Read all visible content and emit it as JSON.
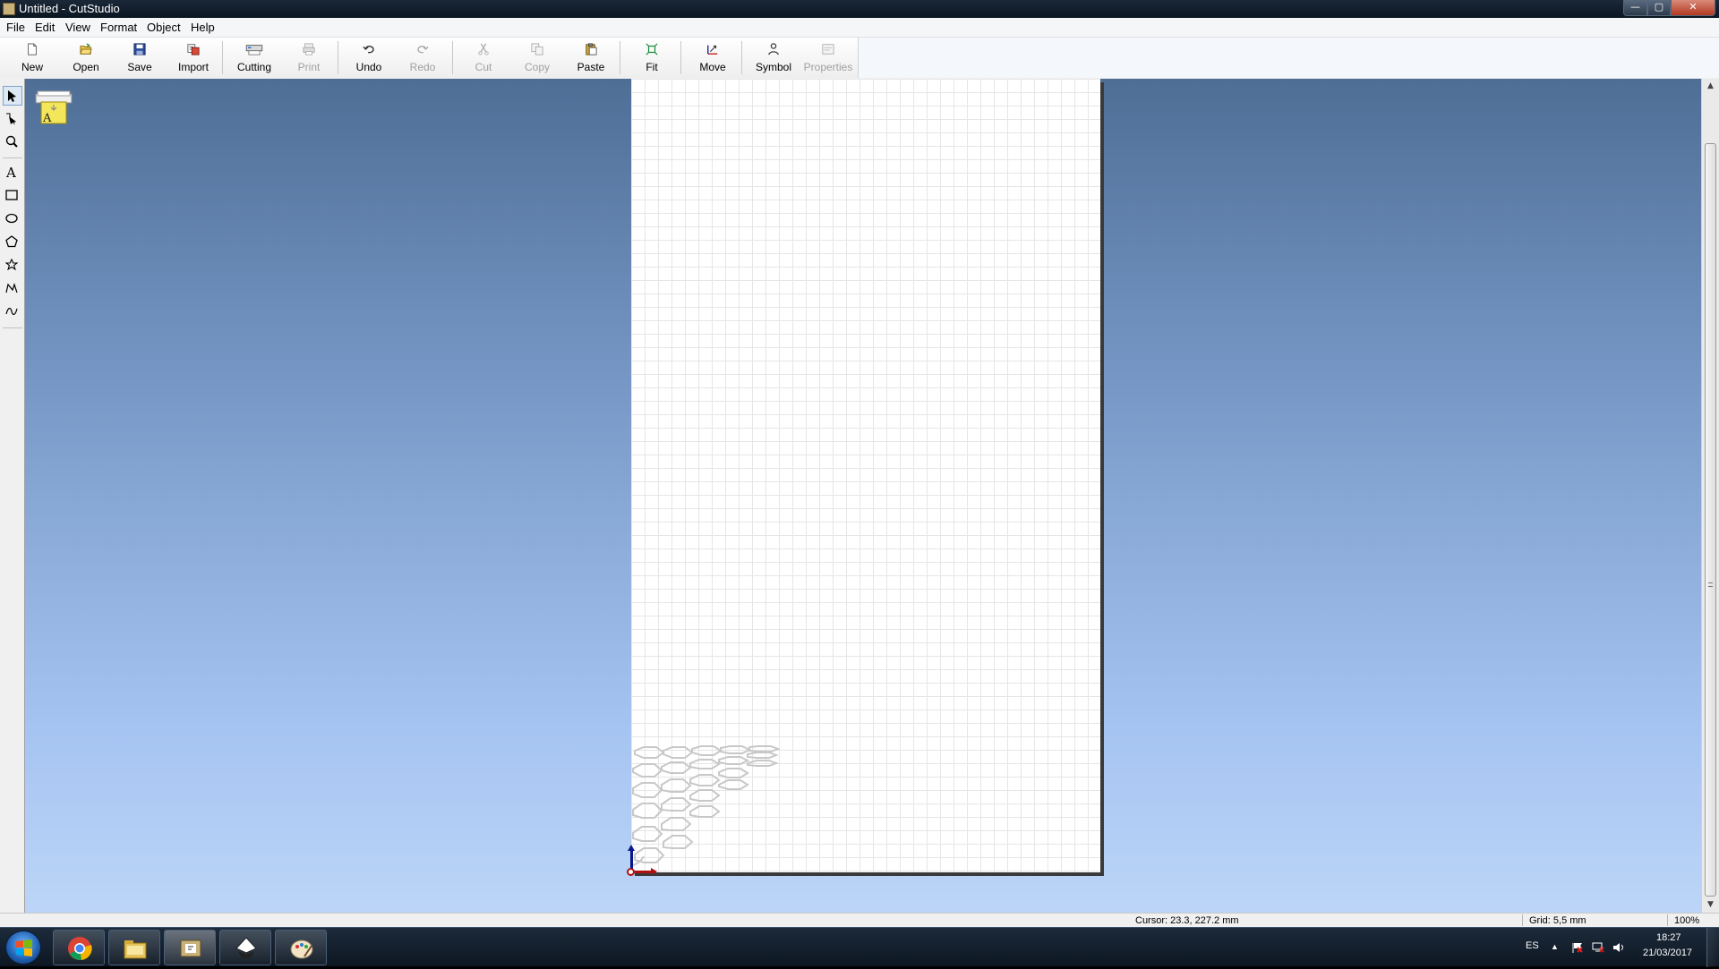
{
  "window": {
    "title": "Untitled - CutStudio",
    "controls": {
      "minimize": "—",
      "maximize": "▢",
      "close": "✕"
    }
  },
  "menu": [
    "File",
    "Edit",
    "View",
    "Format",
    "Object",
    "Help"
  ],
  "toolbar": {
    "new": "New",
    "open": "Open",
    "save": "Save",
    "import": "Import",
    "cutting": "Cutting",
    "print": "Print",
    "undo": "Undo",
    "redo": "Redo",
    "cut": "Cut",
    "copy": "Copy",
    "paste": "Paste",
    "fit": "Fit",
    "move": "Move",
    "symbol": "Symbol",
    "properties": "Properties"
  },
  "tools": [
    "select-arrow-icon",
    "node-edit-icon",
    "zoom-icon",
    "text-icon",
    "rectangle-icon",
    "ellipse-icon",
    "polygon-icon",
    "star-icon",
    "polyline-icon",
    "curve-icon"
  ],
  "text_tool_glyph": "A",
  "printer_label": "A",
  "statusbar": {
    "cursor": "Cursor: 23.3, 227.2 mm",
    "grid": "Grid: 5,5 mm",
    "zoom": "100%"
  },
  "taskbar": {
    "apps": [
      "chrome-icon",
      "file-explorer-icon",
      "cutstudio-icon",
      "inkscape-icon",
      "paint-icon"
    ],
    "language": "ES",
    "tray_up": "▲",
    "time": "18:27",
    "date": "21/03/2017"
  },
  "colors": {
    "canvas_top": "#4e6e96",
    "canvas_bottom": "#bcd5f7",
    "axis_y": "#0a1a8a",
    "axis_x": "#b01010"
  }
}
